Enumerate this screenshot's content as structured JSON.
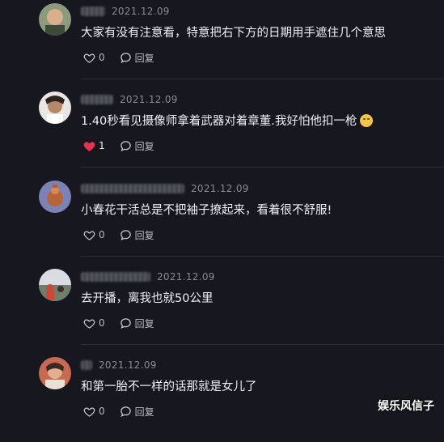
{
  "comments": [
    {
      "date": "2021.12.09",
      "text": "大家有没有注意看，特意把右下方的日期用手遮住几个意思",
      "likes": "0",
      "liked": false,
      "reply": "回复"
    },
    {
      "date": "2021.12.09",
      "text": "1.40秒看见摄像师拿着武器对着章董.我好怕他扣一枪",
      "likes": "1",
      "liked": true,
      "reply": "回复"
    },
    {
      "date": "2021.12.09",
      "text": "小春花干活总是不把袖子撩起来，看着很不舒服!",
      "likes": "0",
      "liked": false,
      "reply": "回复"
    },
    {
      "date": "2021.12.09",
      "text": "去开播，离我也就50公里",
      "likes": "0",
      "liked": false,
      "reply": "回复"
    },
    {
      "date": "2021.12.09",
      "text": "和第一胎不一样的话那就是女儿了",
      "likes": "0",
      "liked": false,
      "reply": "回复"
    }
  ],
  "watermark": "娱乐风信子",
  "colors": {
    "background": "#16171f",
    "like_active": "#e8334d",
    "date": "#8a8b94"
  },
  "icons": {
    "like": "heart-icon",
    "reply": "chat-bubble-icon",
    "emoji": "grinning-face-icon"
  }
}
